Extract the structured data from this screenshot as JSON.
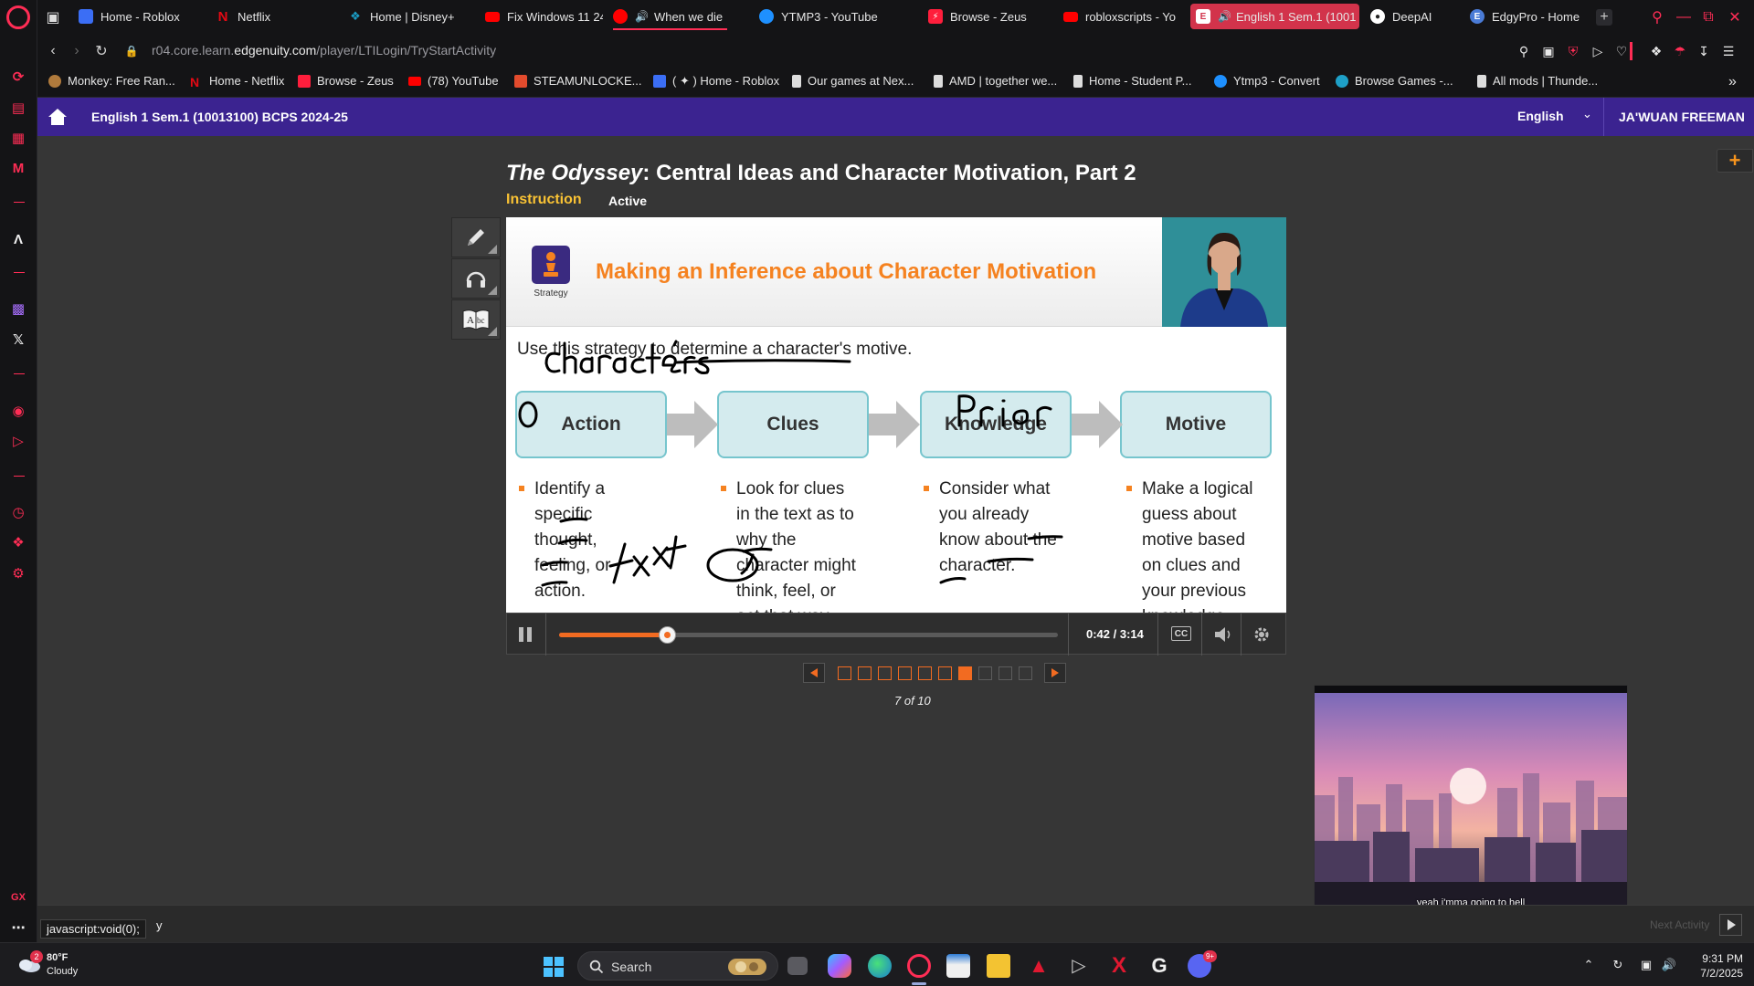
{
  "browser": {
    "tabs": [
      {
        "label": "Home - Roblox",
        "color": "#3b6ef5"
      },
      {
        "label": "Netflix",
        "color": "#e50914"
      },
      {
        "label": "Home | Disney+",
        "color": "#1b9cc4"
      },
      {
        "label": "Fix Windows 11 24",
        "color": "#ff0000"
      },
      {
        "label": "When we die",
        "color": "#ff0000"
      },
      {
        "label": "YTMP3 - YouTube",
        "color": "#1e90ff"
      },
      {
        "label": "Browse - Zeus",
        "color": "#ff1e3c"
      },
      {
        "label": "robloxscripts - Yo",
        "color": "#ff0000"
      },
      {
        "label": "English 1 Sem.1 (1001",
        "color": "#ffffff"
      },
      {
        "label": "DeepAI",
        "color": "#ffffff"
      },
      {
        "label": "EdgyPro - Home",
        "color": "#4a7bd6"
      }
    ],
    "url_prefix": "r04.core.learn.",
    "url_domain": "edgenuity.com",
    "url_path": "/player/LTILogin/TryStartActivity",
    "bookmarks": [
      {
        "label": "Monkey: Free Ran...",
        "color": "#b07a3c"
      },
      {
        "label": "Home - Netflix",
        "color": "#e50914"
      },
      {
        "label": "Browse - Zeus",
        "color": "#ff1e3c"
      },
      {
        "label": "(78) YouTube",
        "color": "#ff0000"
      },
      {
        "label": "STEAMUNLOCKE...",
        "color": "#e34b2d"
      },
      {
        "label": "( ✦ ) Home - Roblox",
        "color": "#3b6ef5"
      },
      {
        "label": "Our games at Nex...",
        "color": "#dddddd"
      },
      {
        "label": "AMD | together we...",
        "color": "#dddddd"
      },
      {
        "label": "Home - Student P...",
        "color": "#dddddd"
      },
      {
        "label": "Ytmp3 - Convert",
        "color": "#1e90ff"
      },
      {
        "label": "Browse Games -...",
        "color": "#1ea0c8"
      },
      {
        "label": "All mods | Thunde...",
        "color": "#dddddd"
      }
    ],
    "accent": "#ff2d55"
  },
  "edgenuity": {
    "course_title": "English 1 Sem.1 (10013100) BCPS 2024-25",
    "language": "English",
    "user": "JA'WUAN FREEMAN",
    "header_color": "#3b2390",
    "lesson_title_italic": "The Odyssey",
    "lesson_title_rest": ": Central Ideas and Character Motivation, Part 2",
    "tab_instruction": "Instruction",
    "tab_status": "Active"
  },
  "slide": {
    "strategy_label": "Strategy",
    "title": "Making an Inference about Character Motivation",
    "intro": "Use this strategy to determine a character's motive.",
    "steps": [
      {
        "label": "Action",
        "bullet": [
          "Identify a",
          "specific",
          "thought,",
          "feeling, or",
          "action."
        ]
      },
      {
        "label": "Clues",
        "bullet": [
          "Look for clues",
          "in the text as to",
          "why the",
          "character might",
          "think, feel, or",
          "act that way."
        ]
      },
      {
        "label": "Knowledge",
        "bullet": [
          "Consider what",
          "you already",
          "know about the",
          "character."
        ]
      },
      {
        "label": "Motive",
        "bullet": [
          "Make a logical",
          "guess about",
          "motive based",
          "on clues and",
          "your previous",
          "knowledge."
        ]
      }
    ],
    "title_color": "#f58220"
  },
  "player": {
    "time": "0:42 / 3:14",
    "progress": 0.2165,
    "cc_label": "CC"
  },
  "pager": {
    "total": 10,
    "current": 7,
    "label": "7 of 10"
  },
  "music_caption": "yeah i'mma going to hell",
  "status_tip": "javascript:void(0);",
  "status_trailing": "y",
  "next_activity": "Next Activity",
  "taskbar": {
    "weather_badge": "2",
    "temperature": "80°F",
    "condition": "Cloudy",
    "search": "Search",
    "time": "9:31 PM",
    "date": "7/2/2025",
    "discord_badge": "9+"
  }
}
